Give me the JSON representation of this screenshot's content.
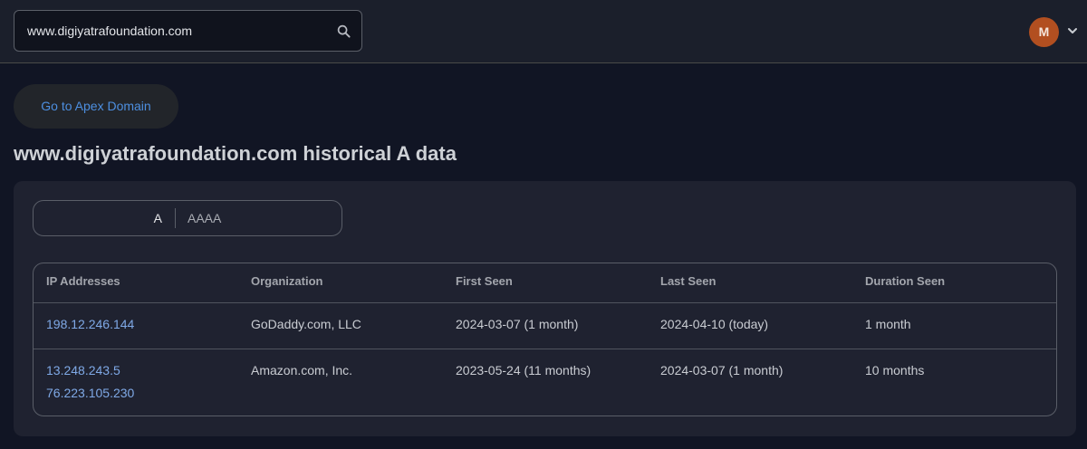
{
  "search": {
    "value": "www.digiyatrafoundation.com"
  },
  "user": {
    "avatar_initial": "M"
  },
  "apex_button": "Go to Apex Domain",
  "page_title": "www.digiyatrafoundation.com historical A data",
  "record_types": {
    "selected": "A",
    "options": [
      "A",
      "AAAA"
    ]
  },
  "table": {
    "headers": [
      "IP Addresses",
      "Organization",
      "First Seen",
      "Last Seen",
      "Duration Seen"
    ],
    "rows": [
      {
        "ips": [
          "198.12.246.144"
        ],
        "organization": "GoDaddy.com, LLC",
        "first_seen": "2024-03-07 (1 month)",
        "last_seen": "2024-04-10 (today)",
        "duration": "1 month"
      },
      {
        "ips": [
          "13.248.243.5",
          "76.223.105.230"
        ],
        "organization": "Amazon.com, Inc.",
        "first_seen": "2023-05-24 (11 months)",
        "last_seen": "2024-03-07 (1 month)",
        "duration": "10 months"
      }
    ]
  },
  "colors": {
    "background": "#111524",
    "topbar": "#1b1f2b",
    "panel": "#1f2230",
    "link": "#7fa9e6",
    "accent_button_text": "#4d8fe0",
    "avatar": "#b24f20"
  },
  "icons": {
    "search": "search-icon",
    "user_menu": "chevron-down-icon"
  }
}
